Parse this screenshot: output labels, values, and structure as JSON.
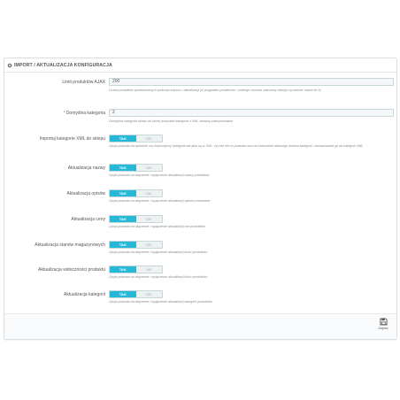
{
  "panel": {
    "title": "IMPORT / AKTUALIZACJA KONFIGURACJA"
  },
  "fields": {
    "limit": {
      "label": "Limit produktów AJAX",
      "value": "200",
      "help": "Liczba produktów przetwarzanych podczas importu / aktualizacji (w przypadku problemów / wolnego serwera zalecamy obniżyć tą wartość nawet do 5)"
    },
    "category": {
      "required": "*",
      "label": "Domyślna kategoria",
      "value": "2",
      "help": "Domyślna kategoria sklepu do której wszystkie kategorie z XML zostaną zaimportowane"
    }
  },
  "toggle_labels": {
    "on": "TAK",
    "off": "NIE"
  },
  "toggles": [
    {
      "label": "Importuj kategorie XML do sklepu",
      "help": "Opcja pozwala na wybranie czy importujemy kategorie tak jaka są w XML, czy też nie co pozwala nam na stworzenie własnego drzewa kategorii i zamapowanie go do kategorii XML"
    },
    {
      "label": "Aktualizacja nazwy",
      "help": "Opcja pozwala na włączenie / wyłączenie aktualizacji nazwy produktów"
    },
    {
      "label": "Aktualizacja opisów",
      "help": "Opcja pozwala na włączenie / wyłączenie aktualizacji opisów produktów"
    },
    {
      "label": "Aktualizacja ceny",
      "help": "Opcja pozwala na włączenie / wyłączenie aktualizacji cen produktów"
    },
    {
      "label": "Aktualizacja stanów magazynowych",
      "help": "Opcja pozwala na włączenie / wyłączenie aktualizacji ilości produktów"
    },
    {
      "label": "Aktualizacja widoczności produktu",
      "help": "Opcja pozwala na włączenie / wyłączenie aktualizacji ilości produktów"
    },
    {
      "label": "Aktualizacja kategorii",
      "help": "Opcja pozwala na włączenie / wyłączenie aktualizacji kategorii produktów"
    }
  ],
  "footer": {
    "save_label": "Zapisz"
  },
  "colors": {
    "accent": "#25b9d7",
    "required": "#e34c4c"
  }
}
